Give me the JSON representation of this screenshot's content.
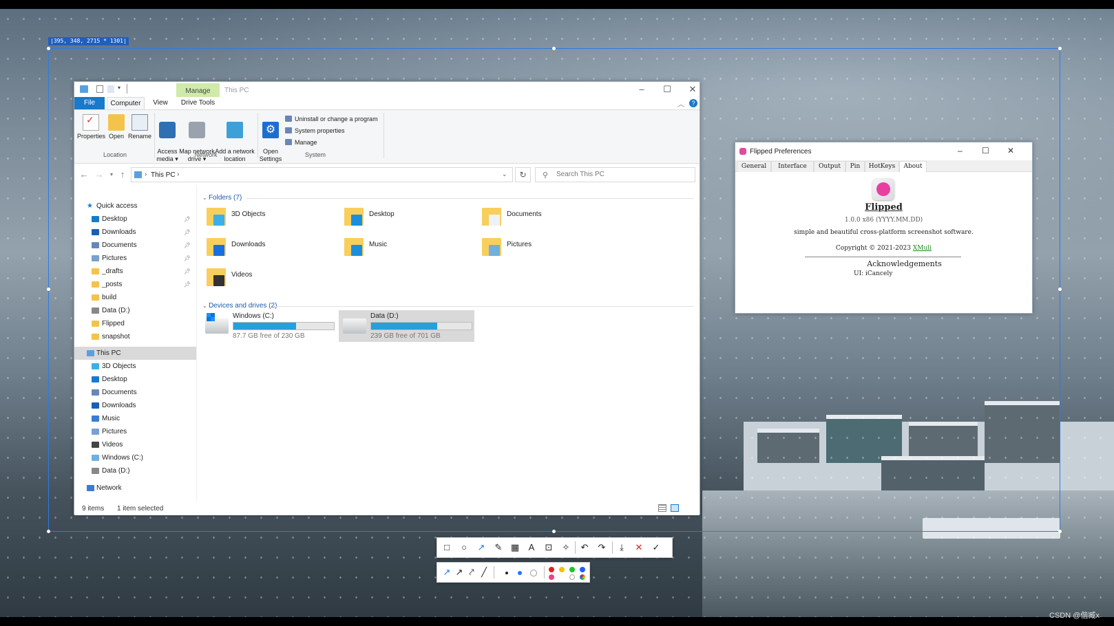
{
  "selection_info": "|395, 348, 2715 * 1301|",
  "explorer": {
    "title": "This PC",
    "manage_tab": "Manage",
    "tabs": {
      "file": "File",
      "computer": "Computer",
      "view": "View",
      "drive_tools": "Drive Tools"
    },
    "ribbon": {
      "location": {
        "group": "Location",
        "buttons": [
          "Properties",
          "Open",
          "Rename"
        ]
      },
      "network": {
        "group": "Network",
        "access_media": "Access\nmedia ▾",
        "map_drive": "Map network\ndrive ▾",
        "add_location": "Add a network\nlocation"
      },
      "system": {
        "group": "System",
        "open_settings": "Open\nSettings",
        "items": [
          "Uninstall or change a program",
          "System properties",
          "Manage"
        ]
      }
    },
    "address": {
      "crumb": "This PC",
      "search_placeholder": "Search This PC"
    },
    "nav": {
      "quick_access": "Quick access",
      "quick_items": [
        "Desktop",
        "Downloads",
        "Documents",
        "Pictures",
        "_drafts",
        "_posts",
        "build",
        "Data (D:)",
        "Flipped",
        "snapshot"
      ],
      "this_pc": "This PC",
      "pc_items": [
        "3D Objects",
        "Desktop",
        "Documents",
        "Downloads",
        "Music",
        "Pictures",
        "Videos",
        "Windows (C:)",
        "Data (D:)"
      ],
      "network": "Network"
    },
    "folders_header": "Folders (7)",
    "folders": [
      "3D Objects",
      "Desktop",
      "Documents",
      "Downloads",
      "Music",
      "Pictures",
      "Videos"
    ],
    "drives_header": "Devices and drives (2)",
    "drives": [
      {
        "name": "Windows (C:)",
        "free": "87.7 GB free of 230 GB",
        "used_fraction": 0.62
      },
      {
        "name": "Data (D:)",
        "free": "239 GB free of 701 GB",
        "used_fraction": 0.66
      }
    ],
    "status": {
      "items": "9 items",
      "selected": "1 item selected"
    }
  },
  "prefs": {
    "title": "Flipped Preferences",
    "tabs": [
      "General",
      "Interface",
      "Output",
      "Pin",
      "HotKeys",
      "About"
    ],
    "app_name": "Flipped",
    "version": "1.0.0 x86 (YYYY.MM.DD)",
    "description": "simple and beautiful cross-platform screenshot software.",
    "copyright": "Copyright © 2021-2023",
    "author": "XMuli",
    "ack_title": "Acknowledgements",
    "ack_line": "UI: iCancely"
  },
  "watermark": "CSDN @偕臧x",
  "colors": {
    "accent": "#1979ca",
    "selection": "#2a7be4",
    "manage_tab": "#cfeaa9",
    "drive_bar": "#26a0da"
  }
}
